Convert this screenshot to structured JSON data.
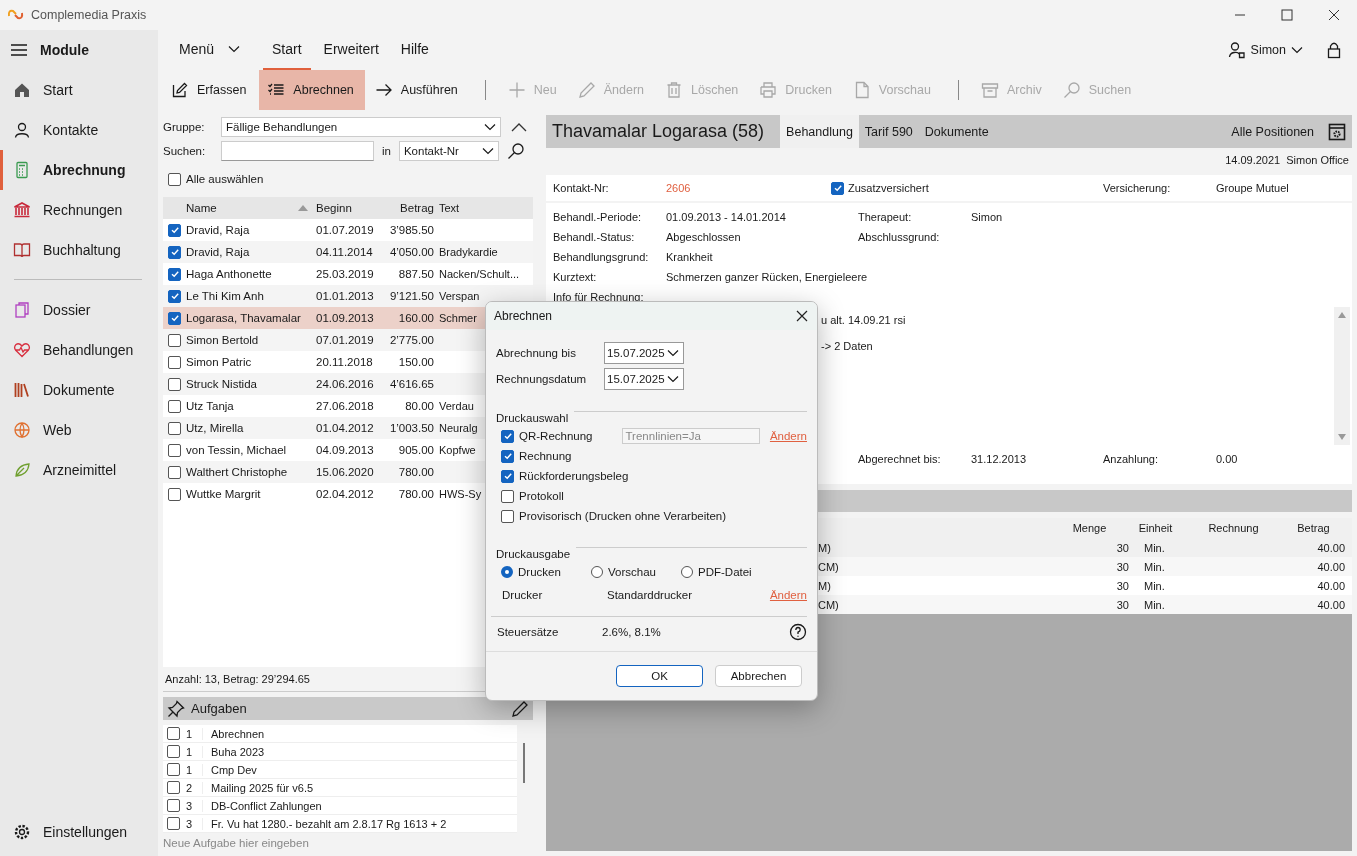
{
  "window": {
    "title": "Complemedia Praxis"
  },
  "sidebar": {
    "title": "Module",
    "items": [
      {
        "label": "Start",
        "selected": false
      },
      {
        "label": "Kontakte",
        "selected": false
      },
      {
        "label": "Abrechnung",
        "selected": true
      },
      {
        "label": "Rechnungen",
        "selected": false
      },
      {
        "label": "Buchhaltung",
        "selected": false
      }
    ],
    "items_2": [
      {
        "label": "Dossier",
        "selected": false
      },
      {
        "label": "Behandlungen",
        "selected": false
      },
      {
        "label": "Dokumente",
        "selected": false
      },
      {
        "label": "Web",
        "selected": false
      },
      {
        "label": "Arzneimittel",
        "selected": false
      }
    ],
    "footer": "Einstellungen"
  },
  "menu": {
    "menu_label": "Menü",
    "tabs": [
      {
        "label": "Start",
        "selected": true
      },
      {
        "label": "Erweitert",
        "selected": false
      },
      {
        "label": "Hilfe",
        "selected": false
      }
    ],
    "user": "Simon"
  },
  "toolbar": {
    "groups": [
      [
        {
          "label": "Erfassen",
          "selected": false,
          "disabled": false
        },
        {
          "label": "Abrechnen",
          "selected": true,
          "disabled": false
        },
        {
          "label": "Ausführen",
          "selected": false,
          "disabled": false
        }
      ],
      [
        {
          "label": "Neu",
          "selected": false,
          "disabled": true
        },
        {
          "label": "Ändern",
          "selected": false,
          "disabled": true
        },
        {
          "label": "Löschen",
          "selected": false,
          "disabled": true
        },
        {
          "label": "Drucken",
          "selected": false,
          "disabled": true
        },
        {
          "label": "Vorschau",
          "selected": false,
          "disabled": true
        }
      ],
      [
        {
          "label": "Archiv",
          "selected": false,
          "disabled": true
        },
        {
          "label": "Suchen",
          "selected": false,
          "disabled": true
        }
      ]
    ]
  },
  "filter": {
    "group_label": "Gruppe:",
    "group_value": "Fällige Behandlungen",
    "search_label": "Suchen:",
    "in_label": "in",
    "search_in": "Kontakt-Nr",
    "select_all": {
      "label": "Alle auswählen",
      "checked": false
    }
  },
  "list": {
    "columns": [
      "Name",
      "Beginn",
      "Betrag",
      "Text"
    ],
    "rows": [
      {
        "checked": true,
        "selected": false,
        "name": "Dravid, Raja",
        "beginn": "01.07.2019",
        "betrag": "3’985.50"
      },
      {
        "checked": true,
        "selected": false,
        "name": "Dravid, Raja",
        "beginn": "04.11.2014",
        "betrag": "4’050.00",
        "text": "Bradykardie"
      },
      {
        "checked": true,
        "selected": false,
        "name": "Haga Anthonette",
        "beginn": "25.03.2019",
        "betrag": "887.50",
        "text": "Nacken/Schult..."
      },
      {
        "checked": true,
        "selected": false,
        "name": "Le Thi Kim Anh",
        "beginn": "01.01.2013",
        "betrag": "9’121.50",
        "text": "Verspan"
      },
      {
        "checked": true,
        "selected": true,
        "name": "Logarasa, Thavamalar",
        "beginn": "01.09.2013",
        "betrag": "160.00",
        "text": "Schmer"
      },
      {
        "checked": false,
        "selected": false,
        "name": "Simon Bertold",
        "beginn": "07.01.2019",
        "betrag": "2’775.00"
      },
      {
        "checked": false,
        "selected": false,
        "name": "Simon Patric",
        "beginn": "20.11.2018",
        "betrag": "150.00"
      },
      {
        "checked": false,
        "selected": false,
        "name": "Struck Nistida",
        "beginn": "24.06.2016",
        "betrag": "4’616.65"
      },
      {
        "checked": false,
        "selected": false,
        "name": "Utz Tanja",
        "beginn": "27.06.2018",
        "betrag": "80.00",
        "text": "Verdau"
      },
      {
        "checked": false,
        "selected": false,
        "name": "Utz, Mirella",
        "beginn": "01.04.2012",
        "betrag": "1’003.50",
        "text": "Neuralg"
      },
      {
        "checked": false,
        "selected": false,
        "name": "von Tessin, Michael",
        "beginn": "04.09.2013",
        "betrag": "905.00",
        "text": "Kopfwe"
      },
      {
        "checked": false,
        "selected": false,
        "name": "Walthert Christophe",
        "beginn": "15.06.2020",
        "betrag": "780.00"
      },
      {
        "checked": false,
        "selected": false,
        "name": "Wuttke Margrit",
        "beginn": "02.04.2012",
        "betrag": "780.00",
        "text": "HWS-Sy"
      }
    ],
    "summary": "Anzahl: 13, Betrag: 29’294.65"
  },
  "tasks": {
    "title": "Aufgaben",
    "items": [
      {
        "checked": false,
        "priority": "1",
        "text": "Abrechnen"
      },
      {
        "checked": false,
        "priority": "1",
        "text": "Buha 2023"
      },
      {
        "checked": false,
        "priority": "1",
        "text": "Cmp Dev"
      },
      {
        "checked": false,
        "priority": "2",
        "text": "Mailing 2025 für v6.5"
      },
      {
        "checked": false,
        "priority": "3",
        "text": "DB-Conflict Zahlungen"
      },
      {
        "checked": false,
        "priority": "3",
        "text": "Fr. Vu hat 1280.- bezahlt am 2.8.17 Rg 1613 + 2"
      }
    ],
    "placeholder": "Neue Aufgabe hier eingeben"
  },
  "detail": {
    "title": "Thavamalar Logarasa (58)",
    "tabs": [
      {
        "label": "Behandlung",
        "selected": true
      },
      {
        "label": "Tarif 590",
        "selected": false
      },
      {
        "label": "Dokumente",
        "selected": false
      }
    ],
    "all_positions": "Alle Positionen",
    "date": "14.09.2021",
    "user": "Simon Office",
    "contact_label": "Kontakt-Nr:",
    "contact_value": "2606",
    "supplementary": {
      "label": "Zusatzversichert",
      "checked": true
    },
    "insurance_label": "Versicherung:",
    "insurance_value": "Groupe Mutuel",
    "fields": [
      {
        "label": "Behandl.-Periode:",
        "value": "01.09.2013  -  14.01.2014",
        "label_2": "Therapeut:",
        "value_2": "Simon"
      },
      {
        "label": "Behandl.-Status:",
        "value": "Abgeschlossen",
        "label_2": "Abschlussgrund:"
      },
      {
        "label": "Behandlungsgrund:",
        "value": "Krankheit"
      },
      {
        "label": "Kurztext:",
        "value": "Schmerzen ganzer Rücken, Energieleere"
      },
      {
        "label": "Info für Rechnung:"
      }
    ],
    "notes": [
      "u alt. 14.09.21 rsi",
      "-> 2 Daten"
    ],
    "bottom_fields": [
      "Abgerechnet bis:",
      "31.12.2013",
      "Anzahlung:",
      "0.00"
    ],
    "positions": {
      "columns": [
        "Menge",
        "Einheit",
        "Rechnung",
        "Betrag"
      ],
      "rows": [
        {
          "column_1": "M)",
          "menge": "30",
          "einheit": "Min.",
          "betrag": "40.00"
        },
        {
          "column_1": "CM)",
          "menge": "30",
          "einheit": "Min.",
          "betrag": "40.00"
        },
        {
          "column_1": "M)",
          "menge": "30",
          "einheit": "Min.",
          "betrag": "40.00"
        },
        {
          "column_1": "CM)",
          "menge": "30",
          "einheit": "Min.",
          "betrag": "40.00"
        }
      ]
    }
  },
  "dialog": {
    "title": "Abrechnen",
    "dates": [
      {
        "label": "Abrechnung bis",
        "value": "15.07.2025"
      },
      {
        "label": "Rechnungsdatum",
        "value": "15.07.2025"
      }
    ],
    "print_selection": {
      "title": "Druckauswahl",
      "options": [
        {
          "label": "QR-Rechnung",
          "checked": true,
          "field": "Trennlinien=Ja",
          "link": "Ändern"
        },
        {
          "label": "Rechnung",
          "checked": true
        },
        {
          "label": "Rückforderungsbeleg",
          "checked": true
        },
        {
          "label": "Protokoll",
          "checked": false
        },
        {
          "label": "Provisorisch (Drucken ohne Verarbeiten)",
          "checked": false
        }
      ]
    },
    "print_output": {
      "title": "Druckausgabe",
      "options": [
        {
          "label": "Drucken",
          "selected": true
        },
        {
          "label": "Vorschau",
          "selected": false
        },
        {
          "label": "PDF-Datei",
          "selected": false
        }
      ],
      "printer_label": "Drucker",
      "printer_value": "Standarddrucker",
      "printer_link": "Ändern"
    },
    "tax_label": "Steuersätze",
    "tax_value": "2.6%, 8.1%",
    "buttons": [
      "OK",
      "Abbrechen"
    ]
  }
}
